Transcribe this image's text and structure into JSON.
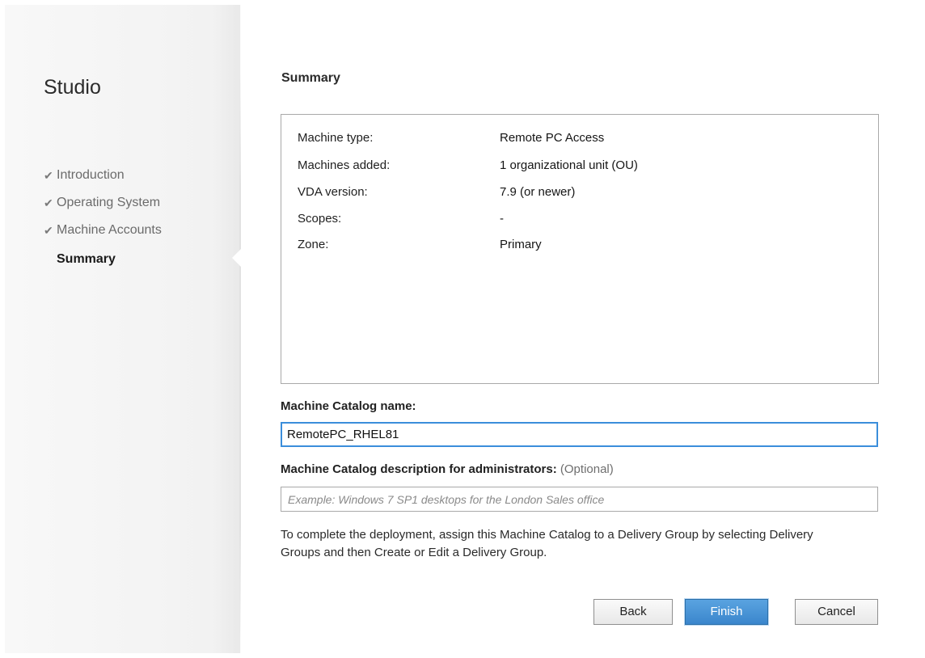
{
  "app": {
    "title": "Studio"
  },
  "steps": [
    {
      "label": "Introduction",
      "done": true
    },
    {
      "label": "Operating System",
      "done": true
    },
    {
      "label": "Machine Accounts",
      "done": true
    },
    {
      "label": "Summary",
      "done": false,
      "current": true
    }
  ],
  "page": {
    "title": "Summary"
  },
  "summary": [
    {
      "key": "Machine type:",
      "value": "Remote PC Access"
    },
    {
      "key": "Machines added:",
      "value": "1 organizational unit (OU)"
    },
    {
      "key": "VDA version:",
      "value": "7.9 (or newer)"
    },
    {
      "key": "Scopes:",
      "value": "-"
    },
    {
      "key": "Zone:",
      "value": "Primary"
    }
  ],
  "catalog_name": {
    "label": "Machine Catalog name:",
    "value": "RemotePC_RHEL81"
  },
  "catalog_description": {
    "label": "Machine Catalog description for administrators:",
    "optional_label": "(Optional)",
    "value": "",
    "placeholder": "Example: Windows 7 SP1 desktops for the London Sales office"
  },
  "info": "To complete the deployment, assign this Machine Catalog to a Delivery Group by selecting Delivery Groups and then Create or Edit a Delivery Group.",
  "buttons": {
    "back": "Back",
    "finish": "Finish",
    "cancel": "Cancel"
  },
  "icons": {
    "step_done": "check-icon"
  },
  "colors": {
    "accent": "#3a86cc",
    "focus_border": "#3b8edb"
  }
}
